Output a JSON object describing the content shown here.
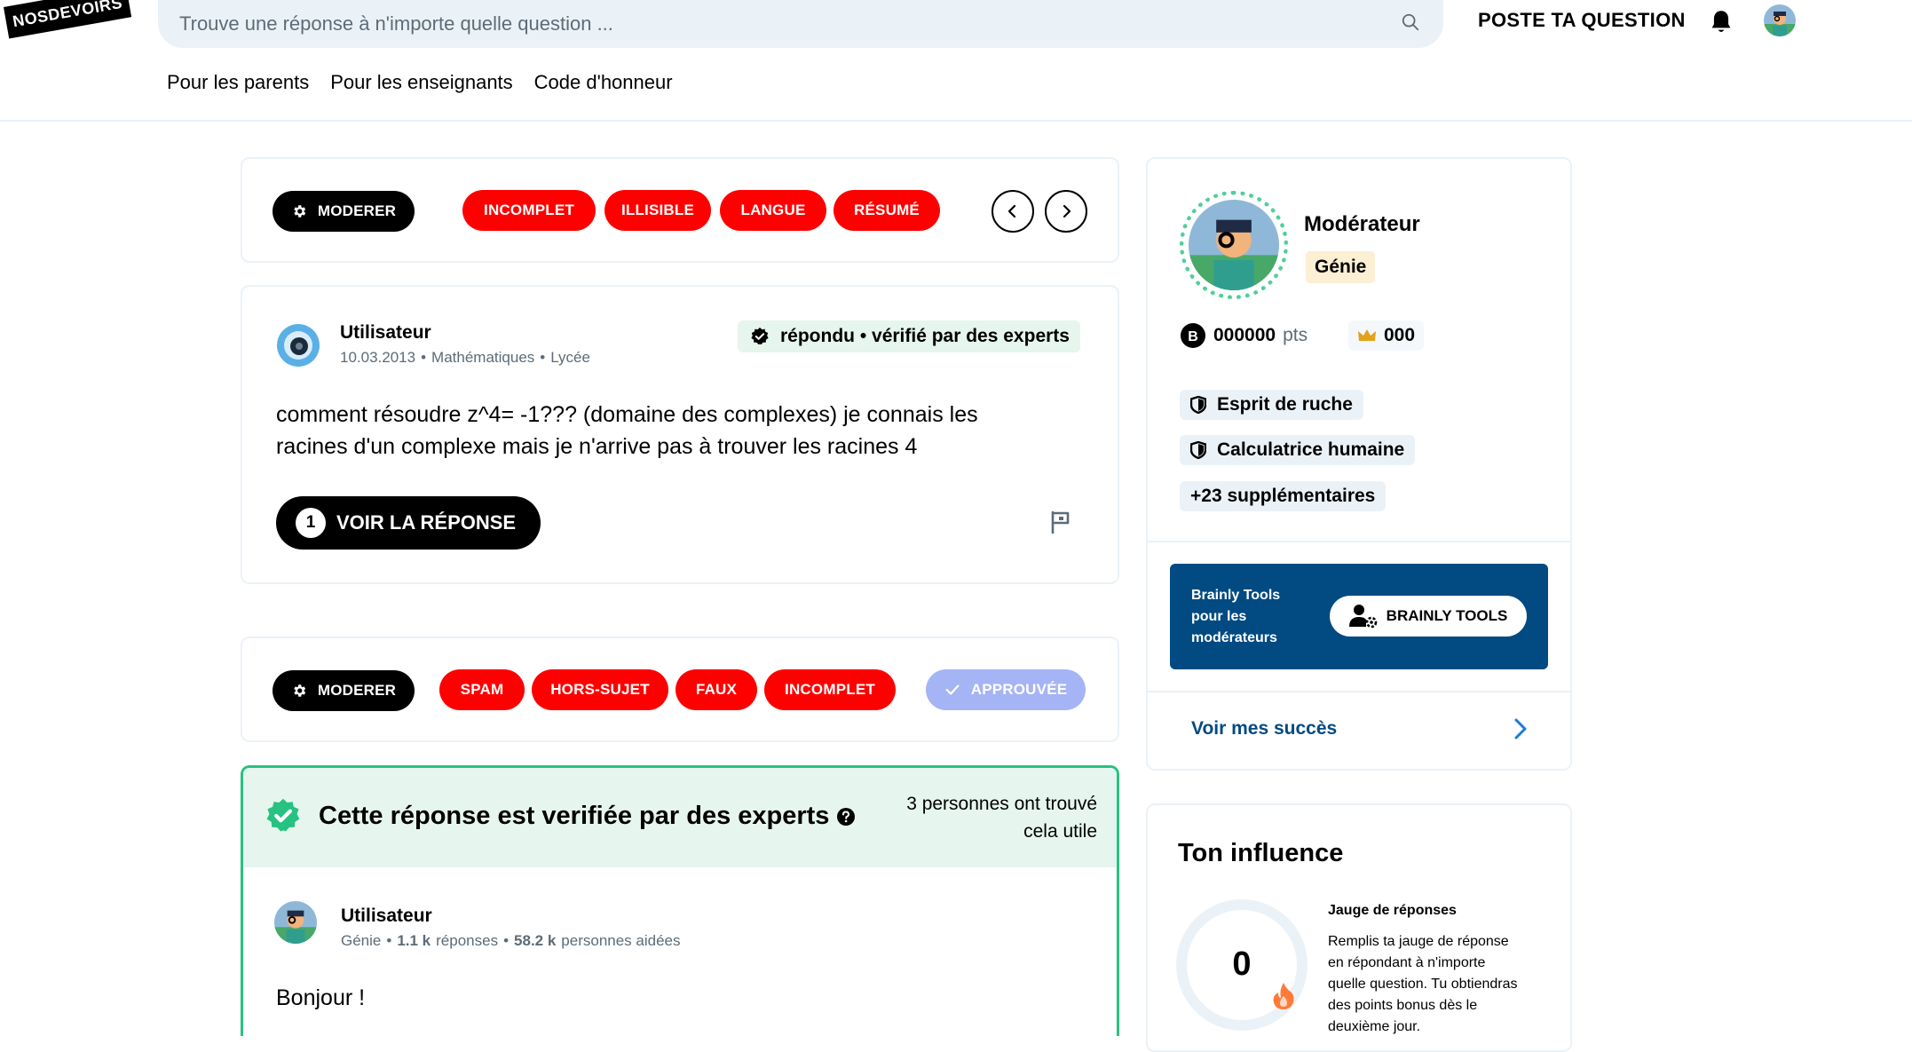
{
  "header": {
    "logo_text": "NOSDEVOIRS",
    "search_placeholder": "Trouve une réponse à n'importe quelle question ...",
    "ask_label": "POSTE TA QUESTION",
    "nav": [
      "Pour les parents",
      "Pour les enseignants",
      "Code d'honneur"
    ]
  },
  "question_moderation": {
    "moderate_label": "MODERER",
    "tags": [
      "INCOMPLET",
      "ILLISIBLE",
      "LANGUE",
      "RÉSUMÉ"
    ]
  },
  "question": {
    "user": "Utilisateur",
    "date": "10.03.2013",
    "subject": "Mathématiques",
    "level": "Lycée",
    "status": "répondu • vérifié par des experts",
    "text_line1": "comment résoudre z^4= -1??? (domaine des complexes) je connais les",
    "text_line2": "racines d'un complexe mais je n'arrive pas à trouver les racines 4",
    "answer_count": "1",
    "answer_button": "VOIR LA RÉPONSE"
  },
  "answer_moderation": {
    "moderate_label": "MODERER",
    "tags": [
      "SPAM",
      "HORS-SUJET",
      "FAUX",
      "INCOMPLET"
    ],
    "approved_label": "APPROUVÉE"
  },
  "answer": {
    "verified_title": "Cette réponse est verifiée par des experts",
    "useful_line1": "3 personnes ont trouvé",
    "useful_line2": "cela utile",
    "user": "Utilisateur",
    "rank": "Génie",
    "answers_count": "1.1 k",
    "answers_label": "réponses",
    "helped_count": "58.2 k",
    "helped_label": "personnes aidées",
    "text": "Bonjour !"
  },
  "profile": {
    "role": "Modérateur",
    "rank": "Génie",
    "points": "000000",
    "points_unit": "pts",
    "crowns": "000",
    "badges": [
      "Esprit de ruche",
      "Calculatrice humaine"
    ],
    "more_badges": "+23 supplémentaires",
    "tools_label_1": "Brainly Tools",
    "tools_label_2": "pour les",
    "tools_label_3": "modérateurs",
    "tools_button": "BRAINLY TOOLS",
    "success_link": "Voir mes succès"
  },
  "influence": {
    "title": "Ton influence",
    "gauge_value": "0",
    "gauge_title": "Jauge de réponses",
    "gauge_text_1": "Remplis ta jauge de réponse",
    "gauge_text_2": "en répondant à n'importe",
    "gauge_text_3": "quelle question. Tu obtiendras",
    "gauge_text_4": "des points bonus dès le",
    "gauge_text_5": "deuxième jour."
  },
  "colors": {
    "accent_red": "#ff0000",
    "verified_green": "#26c281",
    "tools_blue": "#014a82",
    "link_blue": "#014a82"
  }
}
